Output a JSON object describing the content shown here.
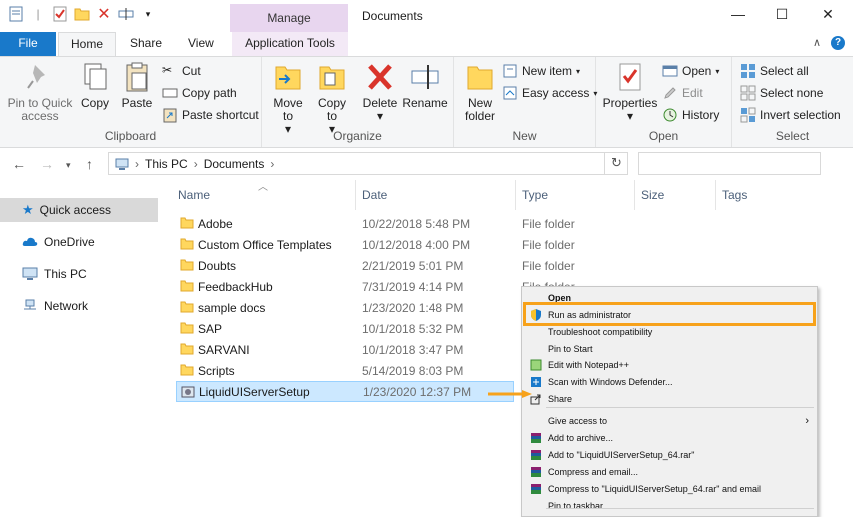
{
  "window": {
    "title": "Documents",
    "manage_label": "Manage",
    "minimize": "—",
    "maximize": "☐",
    "close": "✕"
  },
  "tabs": {
    "file": "File",
    "home": "Home",
    "share": "Share",
    "view": "View",
    "app_tools": "Application Tools"
  },
  "ribbon": {
    "clipboard": {
      "label": "Clipboard",
      "pin": "Pin to Quick access",
      "copy": "Copy",
      "paste": "Paste",
      "cut": "Cut",
      "copy_path": "Copy path",
      "paste_shortcut": "Paste shortcut"
    },
    "organize": {
      "label": "Organize",
      "move_to": "Move to",
      "copy_to": "Copy to",
      "delete": "Delete",
      "rename": "Rename"
    },
    "new": {
      "label": "New",
      "new_folder": "New folder",
      "new_item": "New item",
      "easy_access": "Easy access"
    },
    "open": {
      "label": "Open",
      "properties": "Properties",
      "open": "Open",
      "edit": "Edit",
      "history": "History"
    },
    "select": {
      "label": "Select",
      "select_all": "Select all",
      "select_none": "Select none",
      "invert": "Invert selection"
    }
  },
  "address": {
    "crumb1": "This PC",
    "crumb2": "Documents"
  },
  "navpane": {
    "items": [
      "Quick access",
      "OneDrive",
      "This PC",
      "Network"
    ]
  },
  "columns": {
    "name": "Name",
    "date": "Date",
    "type": "Type",
    "size": "Size",
    "tags": "Tags"
  },
  "files": [
    {
      "name": "Adobe",
      "date": "10/22/2018 5:48 PM",
      "type": "File folder"
    },
    {
      "name": "Custom Office Templates",
      "date": "10/12/2018 4:00 PM",
      "type": "File folder"
    },
    {
      "name": "Doubts",
      "date": "2/21/2019 5:01 PM",
      "type": "File folder"
    },
    {
      "name": "FeedbackHub",
      "date": "7/31/2019 4:14 PM",
      "type": "File folder"
    },
    {
      "name": "sample docs",
      "date": "1/23/2020 1:48 PM",
      "type": ""
    },
    {
      "name": "SAP",
      "date": "10/1/2018 5:32 PM",
      "type": ""
    },
    {
      "name": "SARVANI",
      "date": "10/1/2018 3:47 PM",
      "type": ""
    },
    {
      "name": "Scripts",
      "date": "5/14/2019 8:03 PM",
      "type": ""
    },
    {
      "name": "LiquidUIServerSetup",
      "date": "1/23/2020 12:37 PM",
      "type": ""
    }
  ],
  "context_menu": {
    "items": [
      "Open",
      "Run as administrator",
      "Troubleshoot compatibility",
      "Pin to Start",
      "Edit with Notepad++",
      "Scan with Windows Defender...",
      "Share",
      "Give access to",
      "Add to archive...",
      "Add to \"LiquidUIServerSetup_64.rar\"",
      "Compress and email...",
      "Compress to \"LiquidUIServerSetup_64.rar\" and email",
      "Pin to taskbar"
    ]
  },
  "colors": {
    "accent": "#1979ca",
    "manage": "#e8d6ef",
    "highlight": "#f7a21b",
    "selection": "#cce8ff"
  }
}
